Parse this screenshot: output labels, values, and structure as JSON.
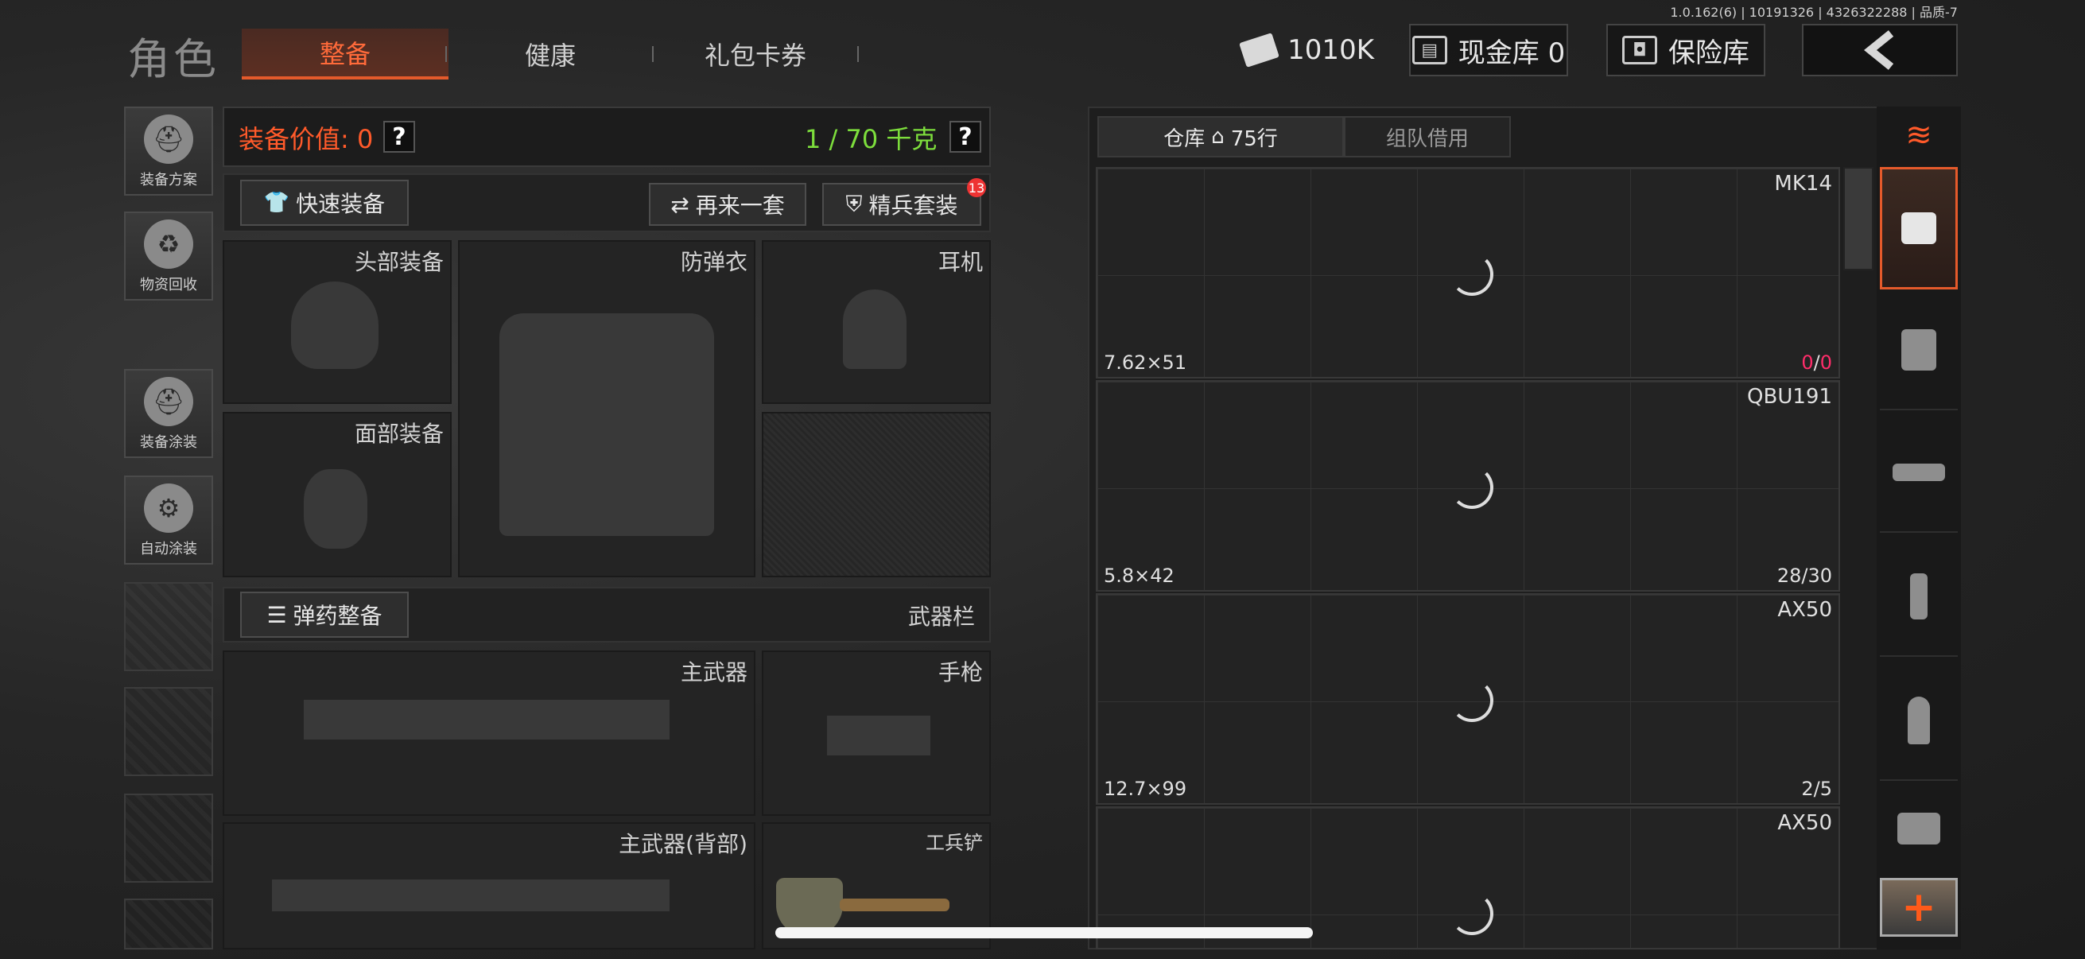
{
  "version": "1.0.162(6) | 10191326 | 4326322288 | 品质-7",
  "header": {
    "title": "角色",
    "tabs": [
      "整备",
      "健康",
      "礼包卡券"
    ],
    "active_tab": 0,
    "money": "1010K",
    "cash_vault": "现金库 0",
    "safe": "保险库"
  },
  "sidebar": [
    {
      "label": "装备方案",
      "icon": "helmet-gear-icon"
    },
    {
      "label": "物资回收",
      "icon": "recycle-icon"
    },
    {
      "label": "装备涂装",
      "icon": "helmet-paint-icon"
    },
    {
      "label": "自动涂装",
      "icon": "brush-gear-icon"
    }
  ],
  "equipment": {
    "value_label": "装备价值: 0",
    "weight": "1 / 70 千克",
    "quick_equip": "快速装备",
    "again": "再来一套",
    "elite": "精兵套装",
    "elite_badge": "13",
    "slots": {
      "head": "头部装备",
      "armor": "防弹衣",
      "earphone": "耳机",
      "face": "面部装备",
      "primary": "主武器",
      "pistol": "手枪",
      "primary_back": "主武器(背部)",
      "shovel": "工兵铲"
    },
    "ammo_equip": "弹药整备",
    "weapon_bar": "武器栏"
  },
  "warehouse": {
    "tab_storage": "仓库",
    "rows": "75行",
    "tab_team": "组队借用",
    "items": [
      {
        "name": "MK14",
        "caliber": "7.62×51",
        "count_a": "0",
        "count_b": "0",
        "count_color": "#ff2d6a"
      },
      {
        "name": "QBU191",
        "caliber": "5.8×42",
        "count": "28/30"
      },
      {
        "name": "AX50",
        "caliber": "12.7×99",
        "count": "2/5"
      },
      {
        "name": "AX50",
        "caliber": "",
        "count": ""
      }
    ]
  },
  "categories": [
    "stack-icon",
    "equip-list-icon",
    "vest-icon",
    "rifle-icon",
    "magazine-icon",
    "bullet-icon",
    "scope-icon"
  ],
  "colors": {
    "accent": "#e55a2b",
    "weight": "#7dde3c",
    "value": "#ff5a2a"
  }
}
